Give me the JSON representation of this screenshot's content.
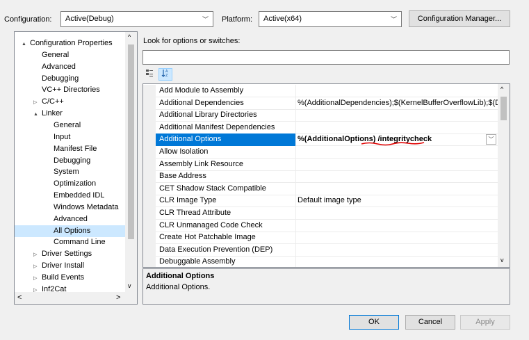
{
  "top": {
    "configuration_label": "Configuration:",
    "configuration_value": "Active(Debug)",
    "platform_label": "Platform:",
    "platform_value": "Active(x64)",
    "config_manager_button": "Configuration Manager..."
  },
  "tree": {
    "items": [
      {
        "label": "Configuration Properties",
        "expander": "▲"
      },
      {
        "label": "General",
        "expander": ""
      },
      {
        "label": "Advanced",
        "expander": ""
      },
      {
        "label": "Debugging",
        "expander": ""
      },
      {
        "label": "VC++ Directories",
        "expander": ""
      },
      {
        "label": "C/C++",
        "expander": "▷"
      },
      {
        "label": "Linker",
        "expander": "▲"
      },
      {
        "label": "General",
        "expander": ""
      },
      {
        "label": "Input",
        "expander": ""
      },
      {
        "label": "Manifest File",
        "expander": ""
      },
      {
        "label": "Debugging",
        "expander": ""
      },
      {
        "label": "System",
        "expander": ""
      },
      {
        "label": "Optimization",
        "expander": ""
      },
      {
        "label": "Embedded IDL",
        "expander": ""
      },
      {
        "label": "Windows Metadata",
        "expander": ""
      },
      {
        "label": "Advanced",
        "expander": ""
      },
      {
        "label": "All Options",
        "expander": ""
      },
      {
        "label": "Command Line",
        "expander": ""
      },
      {
        "label": "Driver Settings",
        "expander": "▷"
      },
      {
        "label": "Driver Install",
        "expander": "▷"
      },
      {
        "label": "Build Events",
        "expander": "▷"
      },
      {
        "label": "Inf2Cat",
        "expander": "▷"
      }
    ],
    "scroll_left": "<",
    "scroll_right": ">",
    "scroll_up": "^",
    "scroll_down": "v"
  },
  "search": {
    "label": "Look for options or switches:",
    "value": ""
  },
  "grid": {
    "rows": [
      {
        "name": "Add Module to Assembly",
        "value": ""
      },
      {
        "name": "Additional Dependencies",
        "value": "%(AdditionalDependencies);$(KernelBufferOverflowLib);$(D"
      },
      {
        "name": "Additional Library Directories",
        "value": ""
      },
      {
        "name": "Additional Manifest Dependencies",
        "value": ""
      },
      {
        "name": "Additional Options",
        "value": "%(AdditionalOptions) /integritycheck"
      },
      {
        "name": "Allow Isolation",
        "value": ""
      },
      {
        "name": "Assembly Link Resource",
        "value": ""
      },
      {
        "name": "Base Address",
        "value": ""
      },
      {
        "name": "CET Shadow Stack Compatible",
        "value": ""
      },
      {
        "name": "CLR Image Type",
        "value": "Default image type"
      },
      {
        "name": "CLR Thread Attribute",
        "value": ""
      },
      {
        "name": "CLR Unmanaged Code Check",
        "value": ""
      },
      {
        "name": "Create Hot Patchable Image",
        "value": ""
      },
      {
        "name": "Data Execution Prevention (DEP)",
        "value": ""
      },
      {
        "name": "Debuggable Assembly",
        "value": ""
      }
    ],
    "scroll_up": "^",
    "scroll_down": "v"
  },
  "description": {
    "title": "Additional Options",
    "text": "Additional Options."
  },
  "buttons": {
    "ok": "OK",
    "cancel": "Cancel",
    "apply": "Apply"
  },
  "colors": {
    "selection": "#0078d7",
    "tree_selection": "#cce8ff",
    "annotation": "#e00000"
  }
}
